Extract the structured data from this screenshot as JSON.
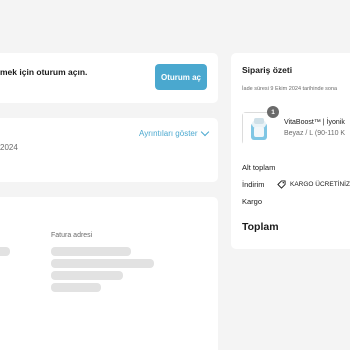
{
  "login": {
    "message": "mek için oturum açın.",
    "button_label": "Oturum aç"
  },
  "details": {
    "toggle_label": "Ayrıntıları göster",
    "date_text": "2024"
  },
  "address": {
    "billing_label": "Fatura adresi"
  },
  "summary": {
    "title": "Sipariş özeti",
    "return_note": "İade süresi 9 Ekim 2024 tarihinde sona",
    "product": {
      "quantity_badge": "1",
      "name": "VitaBoost™ | İyonik",
      "variant": "Beyaz / L (90-110 K"
    },
    "subtotal_label": "Alt toplam",
    "discount_label": "İndirim",
    "discount_code": "KARGO ÜCRETİNİZ",
    "shipping_label": "Kargo",
    "total_label": "Toplam"
  },
  "colors": {
    "accent": "#4aa8cf",
    "background": "#f4f4f4",
    "card": "#ffffff",
    "skeleton": "#e2e2e2"
  },
  "icons": {
    "tag": "tag-icon",
    "chevron": "chevron-down-icon",
    "product": "product-thumbnail"
  }
}
